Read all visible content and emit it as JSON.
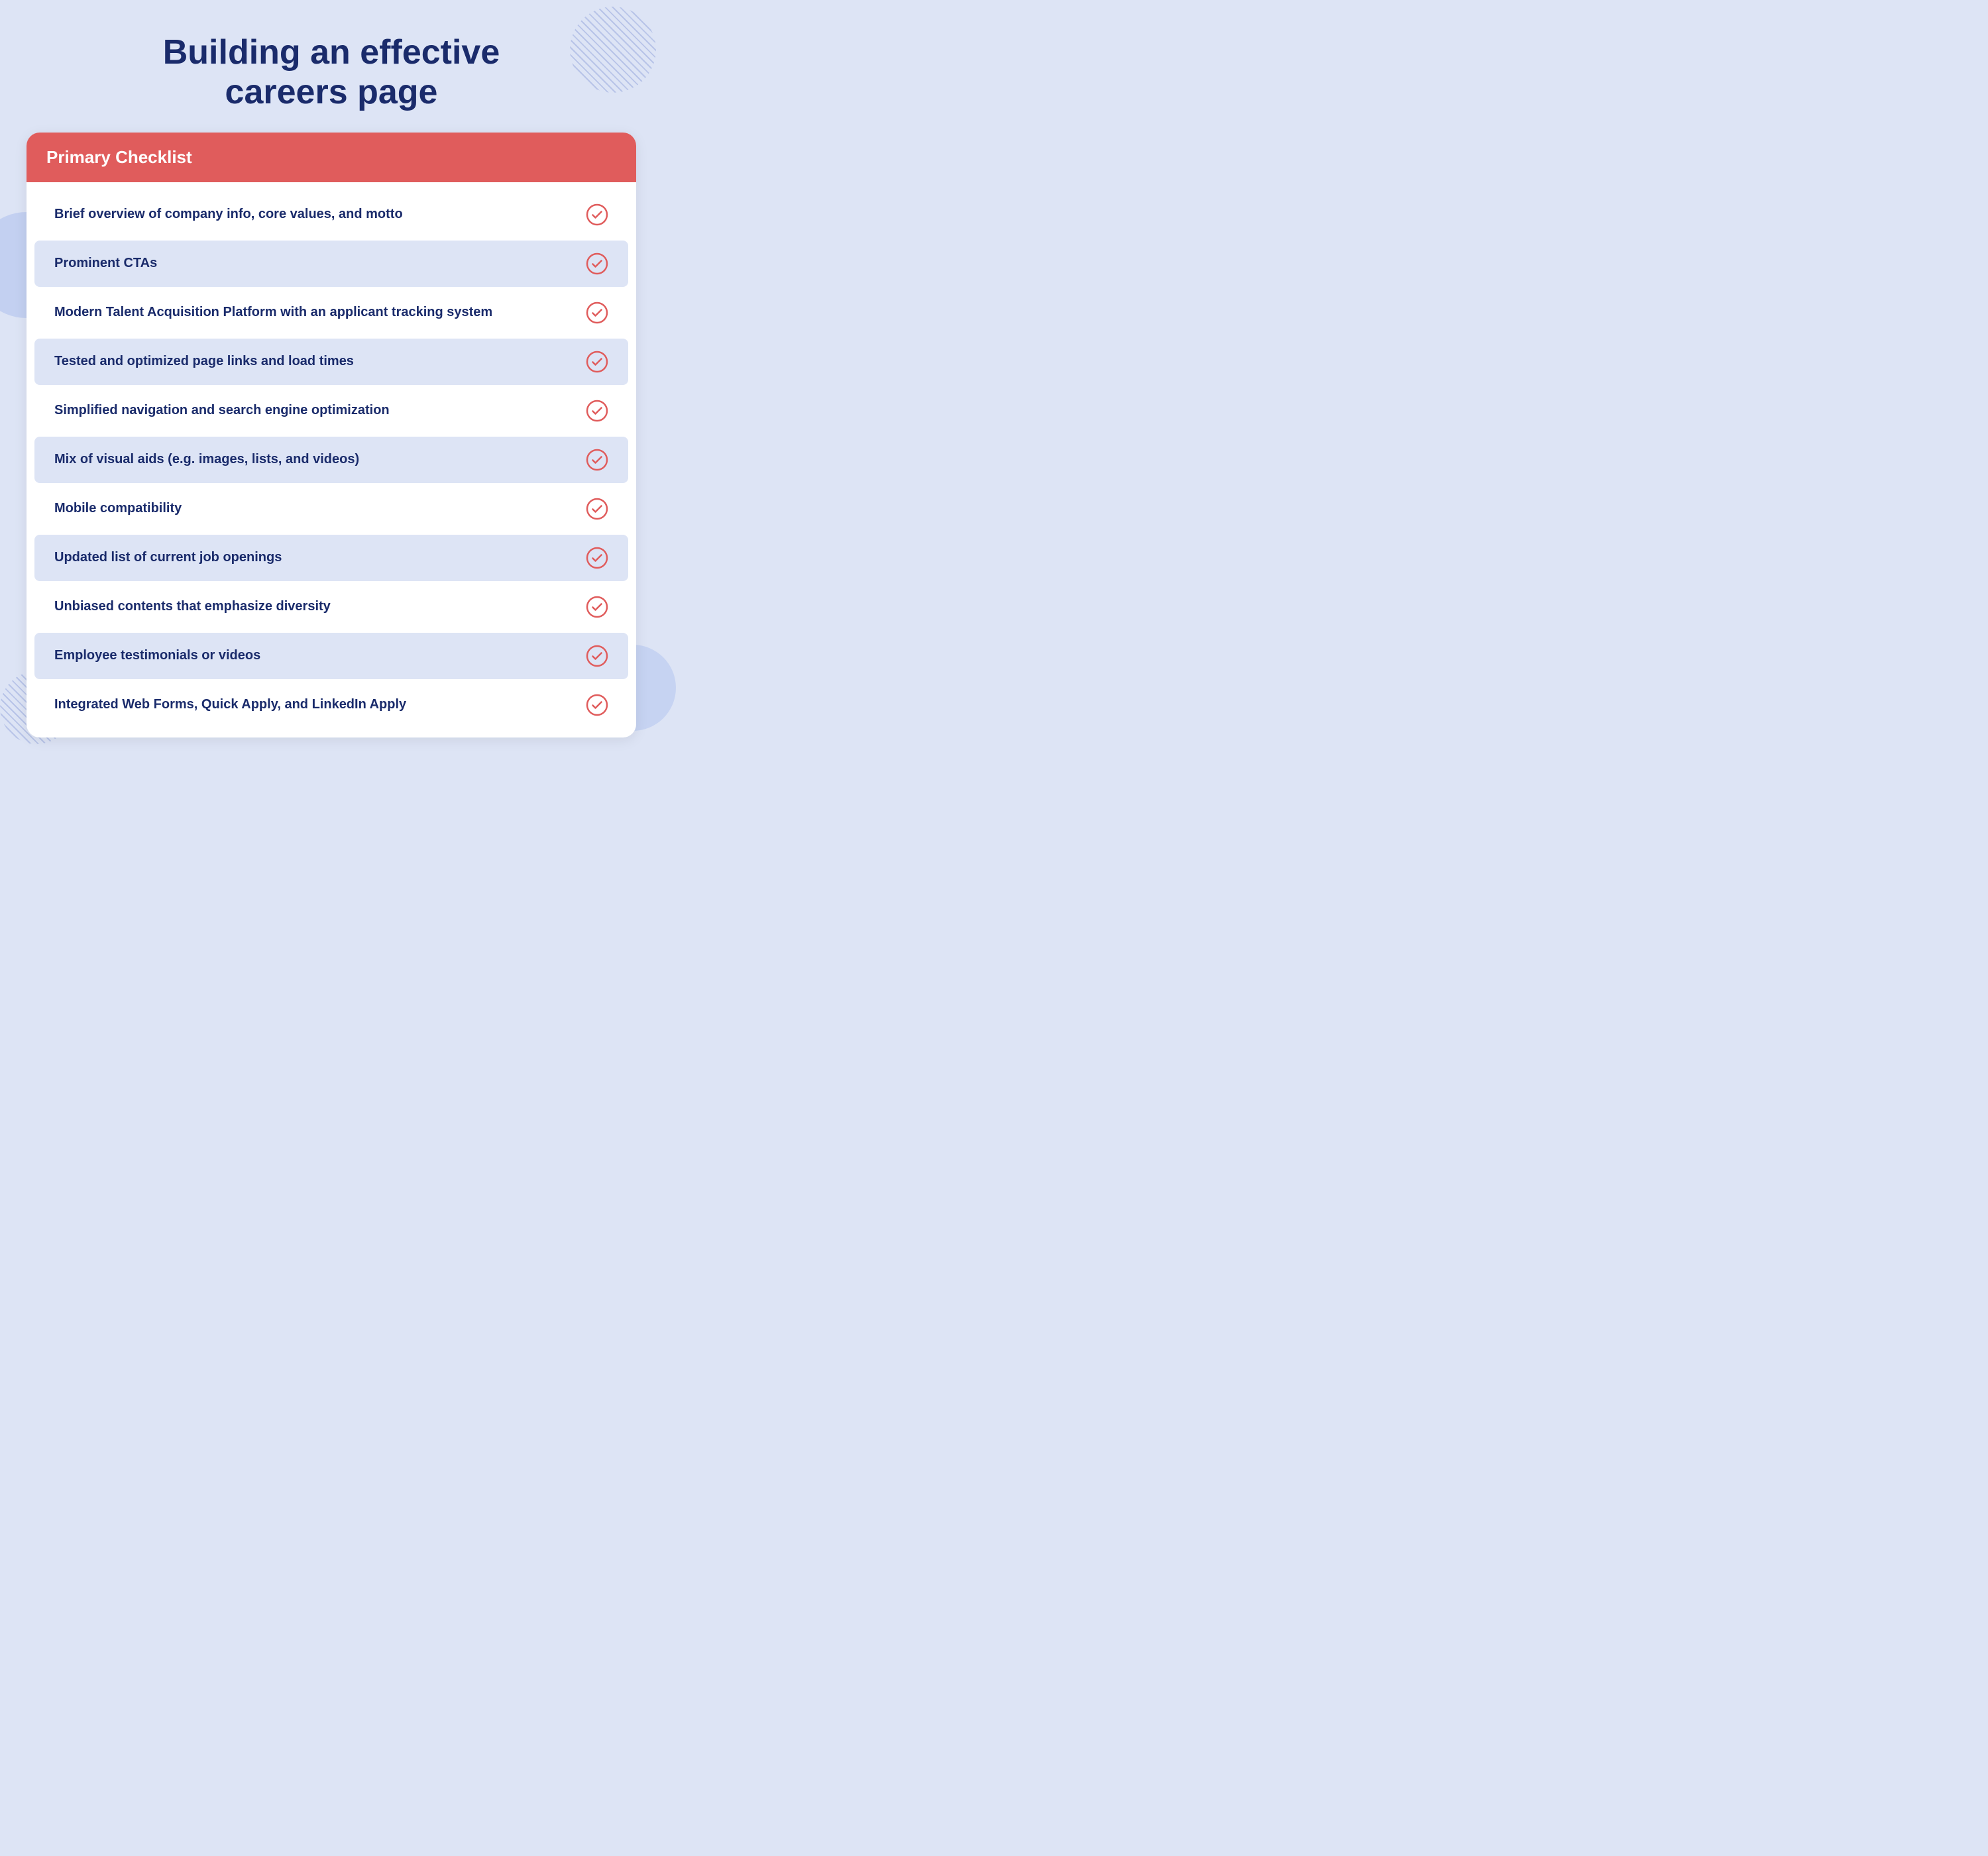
{
  "page": {
    "title_line1": "Building an effective",
    "title_line2": "careers page",
    "background_color": "#dde4f5"
  },
  "card": {
    "header": {
      "title": "Primary Checklist",
      "bg_color": "#e05c5c"
    },
    "rows": [
      {
        "id": 1,
        "label": "Brief overview of company info, core values, and motto",
        "shaded": false
      },
      {
        "id": 2,
        "label": "Prominent CTAs",
        "shaded": true
      },
      {
        "id": 3,
        "label": "Modern Talent Acquisition Platform with an applicant tracking system",
        "shaded": false
      },
      {
        "id": 4,
        "label": "Tested and optimized page links and load times",
        "shaded": true
      },
      {
        "id": 5,
        "label": "Simplified navigation and search engine optimization",
        "shaded": false
      },
      {
        "id": 6,
        "label": "Mix of visual aids (e.g. images, lists, and videos)",
        "shaded": true
      },
      {
        "id": 7,
        "label": "Mobile compatibility",
        "shaded": false
      },
      {
        "id": 8,
        "label": "Updated list of current job openings",
        "shaded": true
      },
      {
        "id": 9,
        "label": "Unbiased contents that emphasize diversity",
        "shaded": false
      },
      {
        "id": 10,
        "label": "Employee testimonials or videos",
        "shaded": true
      },
      {
        "id": 11,
        "label": "Integrated Web Forms, Quick Apply, and LinkedIn Apply",
        "shaded": false
      }
    ]
  },
  "icons": {
    "check_circle": "check-circle-icon"
  }
}
